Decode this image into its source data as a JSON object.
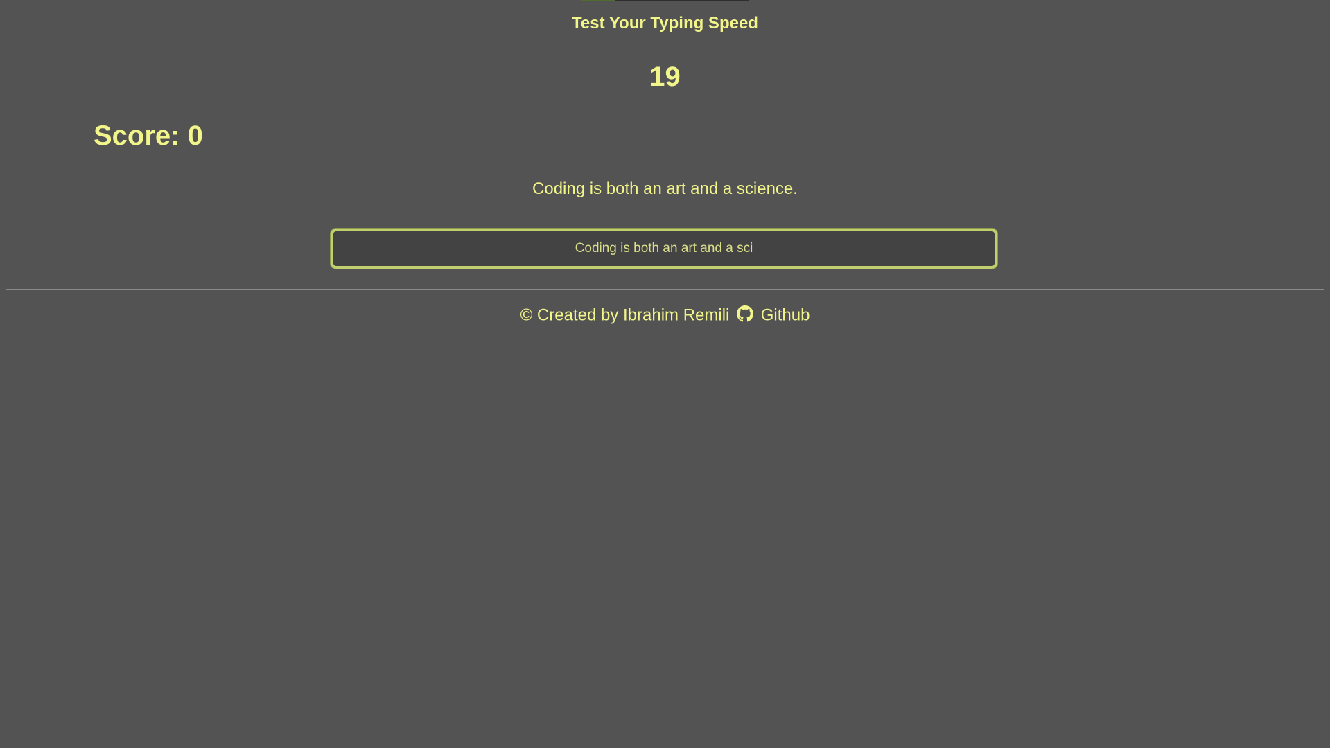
{
  "header": {
    "title": "Test Your Typing Speed",
    "progress_fraction": 0.2
  },
  "game": {
    "timer": "19",
    "score_text": "Score: 0",
    "target_phrase": "Coding is both an art and a science.",
    "input_value": "Coding is both an art and a sci"
  },
  "footer": {
    "credit": "© Created by Ibrahim Remili",
    "github_label": "Github",
    "icon": "github-icon"
  },
  "colors": {
    "background": "#535353",
    "text_accent": "#f2f58a",
    "input_background": "#434343",
    "input_border": "#c2cf6e"
  }
}
